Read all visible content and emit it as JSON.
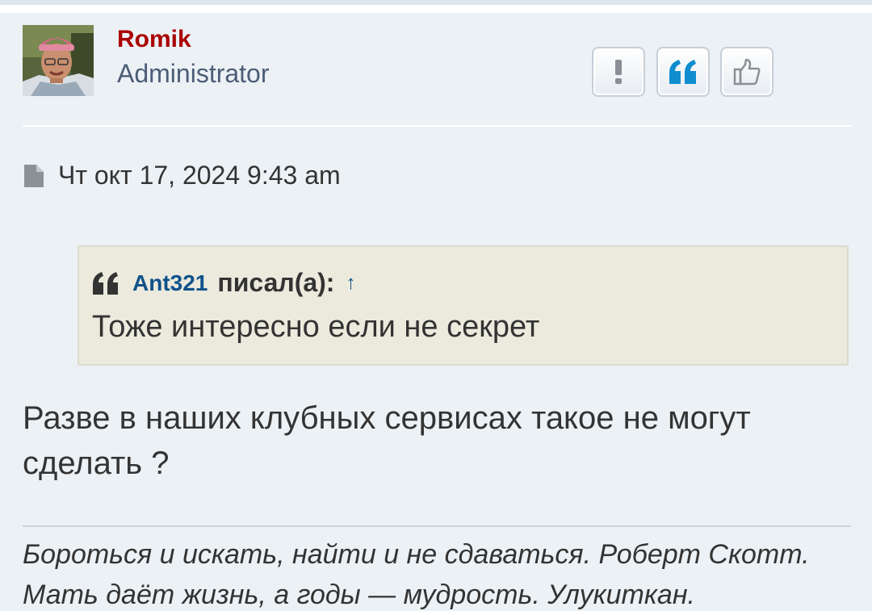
{
  "post": {
    "author": "Romik",
    "rank": "Administrator",
    "date": "Чт окт 17, 2024 9:43 am",
    "actions": {
      "report_icon": "exclamation-icon",
      "quote_icon": "quote-icon",
      "like_icon": "thumbs-up-icon"
    },
    "quote": {
      "author": "Ant321",
      "wrote": "писал(а):",
      "arrow": "↑",
      "text": "Тоже интересно если не секрет"
    },
    "body_line1": "Разве в наших клубных сервисах такое не могут",
    "body_line2": "сделать ?",
    "signature_line1": "Бороться и искать, найти и не сдаваться. Роберт Скотт.",
    "signature_line2": "Мать даёт жизнь, а годы — мудрость. Улукиткан."
  },
  "colors": {
    "author": "#aa0000",
    "rank": "#4c5d77",
    "link": "#105289",
    "post_bg": "#ecf1f5",
    "quote_bg": "#ebeadd"
  }
}
